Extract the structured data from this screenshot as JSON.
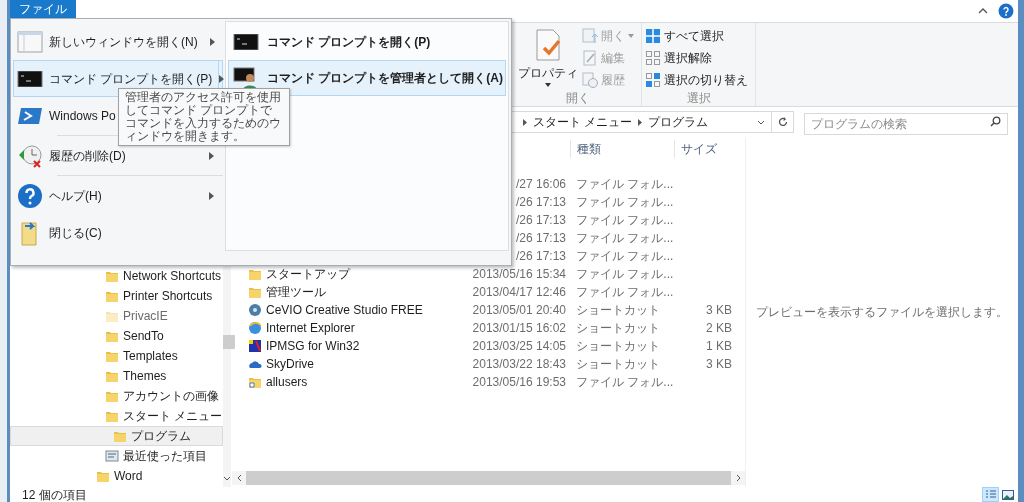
{
  "menu": {
    "tab": {
      "label": "ファイル",
      "selected": true
    },
    "items": [
      {
        "kind": "window",
        "label": "新しいウィンドウを開く(N)",
        "submenu": true,
        "selected": false
      },
      {
        "kind": "cmd",
        "label": "コマンド プロンプトを開く(P)",
        "submenu": true,
        "selected": true
      },
      {
        "kind": "powershell",
        "label": "Windows Po",
        "selected": false
      },
      {
        "kind": "divider"
      },
      {
        "kind": "history",
        "label": "履歴の削除(D)",
        "submenu": true,
        "selected": false
      },
      {
        "kind": "divider"
      },
      {
        "kind": "help",
        "label": "ヘルプ(H)",
        "submenu": true,
        "selected": false
      },
      {
        "kind": "close",
        "label": "閉じる(C)",
        "selected": false
      }
    ],
    "submenu": [
      {
        "kind": "cmd",
        "label": "コマンド プロンプトを開く(P)",
        "selected": false
      },
      {
        "kind": "cmd-admin",
        "label": "コマンド プロンプトを管理者として開く(A)",
        "selected": true
      }
    ],
    "tooltip": "管理者のアクセス許可を使用してコマンド プロンプトでコマンドを入力するためのウィンドウを開きます。"
  },
  "ribbon": {
    "groups": [
      {
        "label": "開く",
        "buttons": [
          {
            "kind": "large",
            "label": "プロパティ",
            "dropdown": true,
            "disabled": false
          },
          {
            "kind": "small",
            "label": "開く",
            "dropdown": true,
            "disabled": true
          },
          {
            "kind": "small",
            "label": "編集",
            "dropdown": false,
            "disabled": true
          },
          {
            "kind": "small",
            "label": "履歴",
            "dropdown": false,
            "disabled": true
          }
        ]
      },
      {
        "label": "選択",
        "buttons": [
          {
            "kind": "small",
            "label": "すべて選択",
            "dropdown": false,
            "disabled": false
          },
          {
            "kind": "small",
            "label": "選択解除",
            "dropdown": false,
            "disabled": false
          },
          {
            "kind": "small",
            "label": "選択の切り替え",
            "dropdown": false,
            "disabled": false
          }
        ]
      }
    ]
  },
  "address": {
    "crumbs": [
      "スタート メニュー",
      "プログラム"
    ]
  },
  "search": {
    "placeholder": "プログラムの検索"
  },
  "nav": {
    "items": [
      {
        "kind": "folder",
        "label": "Network Shortcuts",
        "hidden": false,
        "selected": false
      },
      {
        "kind": "folder",
        "label": "Printer Shortcuts",
        "hidden": false,
        "selected": false
      },
      {
        "kind": "folder",
        "label": "PrivacIE",
        "hidden": true,
        "selected": false
      },
      {
        "kind": "folder",
        "label": "SendTo",
        "hidden": false,
        "selected": false
      },
      {
        "kind": "folder",
        "label": "Templates",
        "hidden": false,
        "selected": false
      },
      {
        "kind": "folder",
        "label": "Themes",
        "hidden": false,
        "selected": false
      },
      {
        "kind": "folder",
        "label": "アカウントの画像",
        "hidden": false,
        "selected": false
      },
      {
        "kind": "folder",
        "label": "スタート メニュー",
        "hidden": false,
        "selected": false,
        "children": [
          {
            "kind": "folder",
            "label": "プログラム",
            "hidden": false,
            "selected": true
          }
        ]
      },
      {
        "kind": "recent",
        "label": "最近使った項目",
        "hidden": false,
        "selected": false
      }
    ],
    "outer_items": [
      {
        "kind": "folder",
        "label": "Word",
        "hidden": false,
        "selected": false
      }
    ]
  },
  "file_list": {
    "columns": {
      "type": "種類",
      "size": "サイズ"
    },
    "rows": [
      {
        "date": "/27 16:06",
        "type": "ファイル フォル..."
      },
      {
        "date": "/26 17:13",
        "type": "ファイル フォル..."
      },
      {
        "date": "/26 17:13",
        "type": "ファイル フォル..."
      },
      {
        "date": "/26 17:13",
        "type": "ファイル フォル..."
      },
      {
        "date": "/26 17:13",
        "type": "ファイル フォル..."
      },
      {
        "kind": "folder",
        "name": "スタートアップ",
        "date": "2013/05/16 15:34",
        "type": "ファイル フォル..."
      },
      {
        "kind": "folder",
        "name": "管理ツール",
        "date": "2013/04/17 12:46",
        "type": "ファイル フォル..."
      },
      {
        "kind": "disc",
        "name": "CeVIO Creative Studio FREE",
        "date": "2013/05/01 20:40",
        "type": "ショートカット",
        "size": "3 KB"
      },
      {
        "kind": "globe",
        "name": "Internet Explorer",
        "date": "2013/01/15 16:02",
        "type": "ショートカット",
        "size": "2 KB"
      },
      {
        "kind": "app",
        "name": "IPMSG for Win32",
        "date": "2013/03/25 14:05",
        "type": "ショートカット",
        "size": "1 KB"
      },
      {
        "kind": "cloud",
        "name": "SkyDrive",
        "date": "2013/03/22 18:43",
        "type": "ショートカット",
        "size": "3 KB"
      },
      {
        "kind": "folder-shortcut",
        "name": "allusers",
        "date": "2013/05/16 19:53",
        "type": "ファイル フォル..."
      }
    ]
  },
  "preview": {
    "message": "プレビューを表示するファイルを選択します。"
  },
  "status_bar": {
    "item_count": "12 個の項目",
    "views": [
      {
        "kind": "details",
        "selected": true
      },
      {
        "kind": "large-icons",
        "selected": false
      }
    ]
  }
}
